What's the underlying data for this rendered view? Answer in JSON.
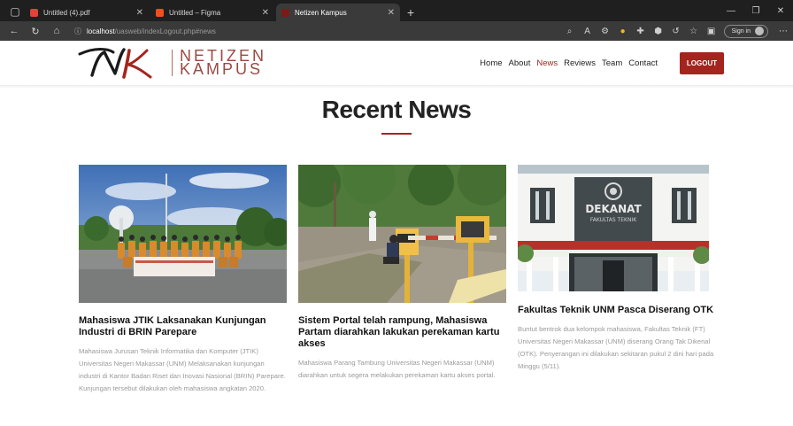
{
  "browser": {
    "tabs": [
      {
        "title": "Untitled (4).pdf",
        "icon": "pdf-icon",
        "color": "#e0433a"
      },
      {
        "title": "Untitled – Figma",
        "icon": "figma-icon",
        "color": "#f24e1e"
      },
      {
        "title": "Netizen Kampus",
        "icon": "site-icon",
        "color": "#7a1c16"
      }
    ],
    "url_host": "localhost",
    "url_path": "/uasweb/indexLogout.php#news",
    "signin_label": "Sign in"
  },
  "site": {
    "logo_text_line1": "NETIZEN",
    "logo_text_line2": "KAMPUS",
    "nav": [
      {
        "label": "Home",
        "active": false
      },
      {
        "label": "About",
        "active": false
      },
      {
        "label": "News",
        "active": true
      },
      {
        "label": "Reviews",
        "active": false
      },
      {
        "label": "Team",
        "active": false
      },
      {
        "label": "Contact",
        "active": false
      }
    ],
    "logout_label": "LOGOUT",
    "accent": "#a3251d"
  },
  "news": {
    "title": "Recent News",
    "items": [
      {
        "headline": "Mahasiswa JTIK Laksanakan Kunjungan Industri di BRIN Parepare",
        "summary": "Mahasiswa Jurusan Teknik Informatika dan Komputer (JTIK) Universitas Negeri Makassar (UNM) Melaksanakan kunjungan industri di Kantor Badan Riset dan Inovasi Nasional (BRIN) Parepare. Kunjungan tersebut dilakukan oleh mahasiswa angkatan 2020."
      },
      {
        "headline": "Sistem Portal telah rampung, Mahasiswa Partam diarahkan lakukan perekaman kartu akses",
        "summary": "Mahasiswa Parang Tambung Universitas Negeri Makassar (UNM) diarahkan untuk segera melakukan perekaman kartu akses portal."
      },
      {
        "headline": "Fakultas Teknik UNM Pasca Diserang OTK",
        "summary": "Buntut bentrok dua kelompok mahasiswa, Fakultas Teknik (FT) Universitas Negeri Makassar (UNM) diserang Orang Tak Dikenal (OTK). Penyerangan ini dilakukan sekitaran pukul 2 dini hari pada Minggu (5/11).",
        "building_sign_line1": "DEKANAT",
        "building_sign_line2": "FAKULTAS TEKNIK"
      }
    ]
  }
}
